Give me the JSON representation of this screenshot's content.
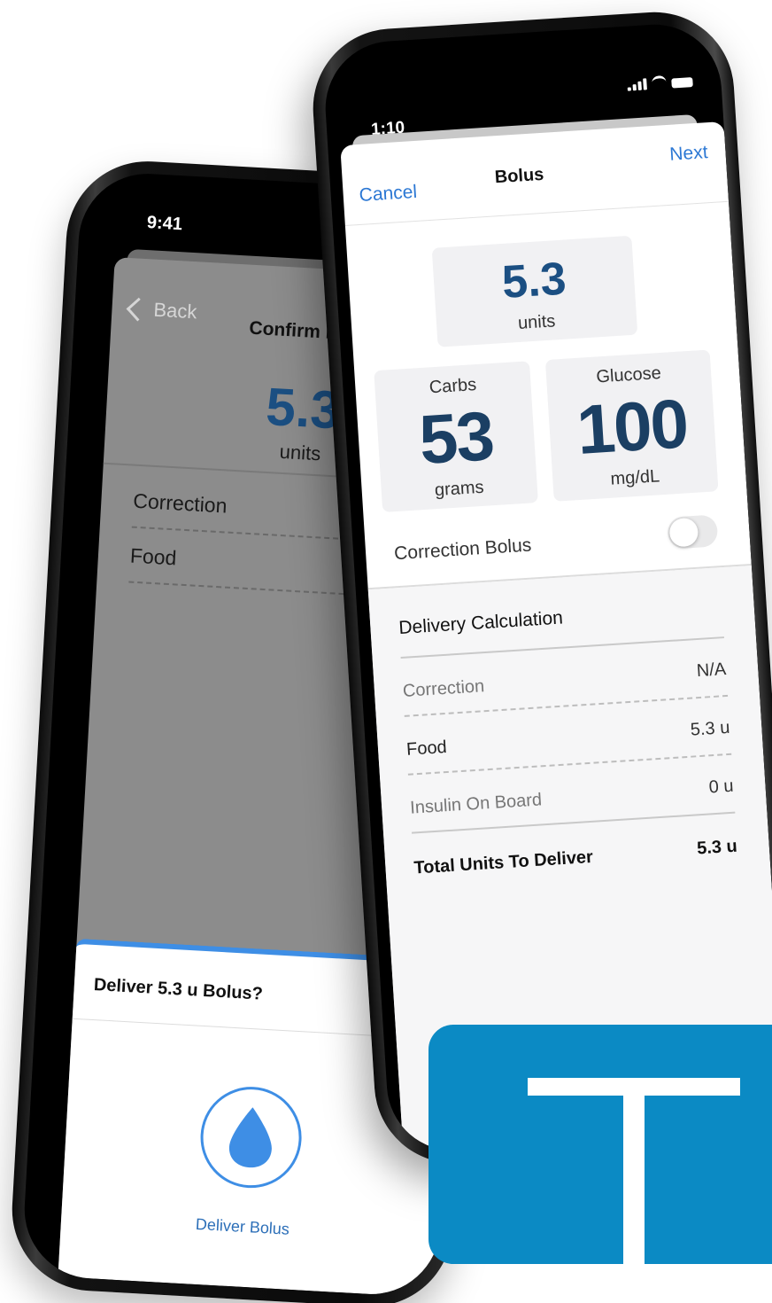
{
  "back_phone": {
    "time": "9:41",
    "back_label": "Back",
    "title": "Confirm Bolus",
    "amount": "5.3",
    "units": "units",
    "rows": [
      {
        "label": "Correction"
      },
      {
        "label": "Food"
      }
    ],
    "sheet": {
      "title": "Deliver 5.3 u Bolus?",
      "button_label": "Deliver Bolus",
      "icon": "water-drop-icon"
    }
  },
  "front_phone": {
    "time": "1:10",
    "status_icons": [
      "signal-icon",
      "wifi-icon",
      "battery-icon"
    ],
    "nav": {
      "cancel": "Cancel",
      "title": "Bolus",
      "next": "Next"
    },
    "amount": {
      "value": "5.3",
      "units": "units"
    },
    "carbs": {
      "label": "Carbs",
      "value": "53",
      "unit": "grams"
    },
    "glucose": {
      "label": "Glucose",
      "value": "100",
      "unit": "mg/dL"
    },
    "correction_bolus": {
      "label": "Correction Bolus",
      "enabled": false
    },
    "calculation": {
      "title": "Delivery Calculation",
      "rows": [
        {
          "label": "Correction",
          "value": "N/A"
        },
        {
          "label": "Food",
          "value": "5.3 u"
        },
        {
          "label": "Insulin On Board",
          "value": "0 u"
        }
      ],
      "total": {
        "label": "Total Units To Deliver",
        "value": "5.3 u"
      }
    }
  },
  "colors": {
    "accent_blue": "#2c78d4",
    "amount_blue": "#1b4f82",
    "logo_blue": "#0b8ac4"
  },
  "logo": {
    "icon": "t-logo-icon"
  }
}
